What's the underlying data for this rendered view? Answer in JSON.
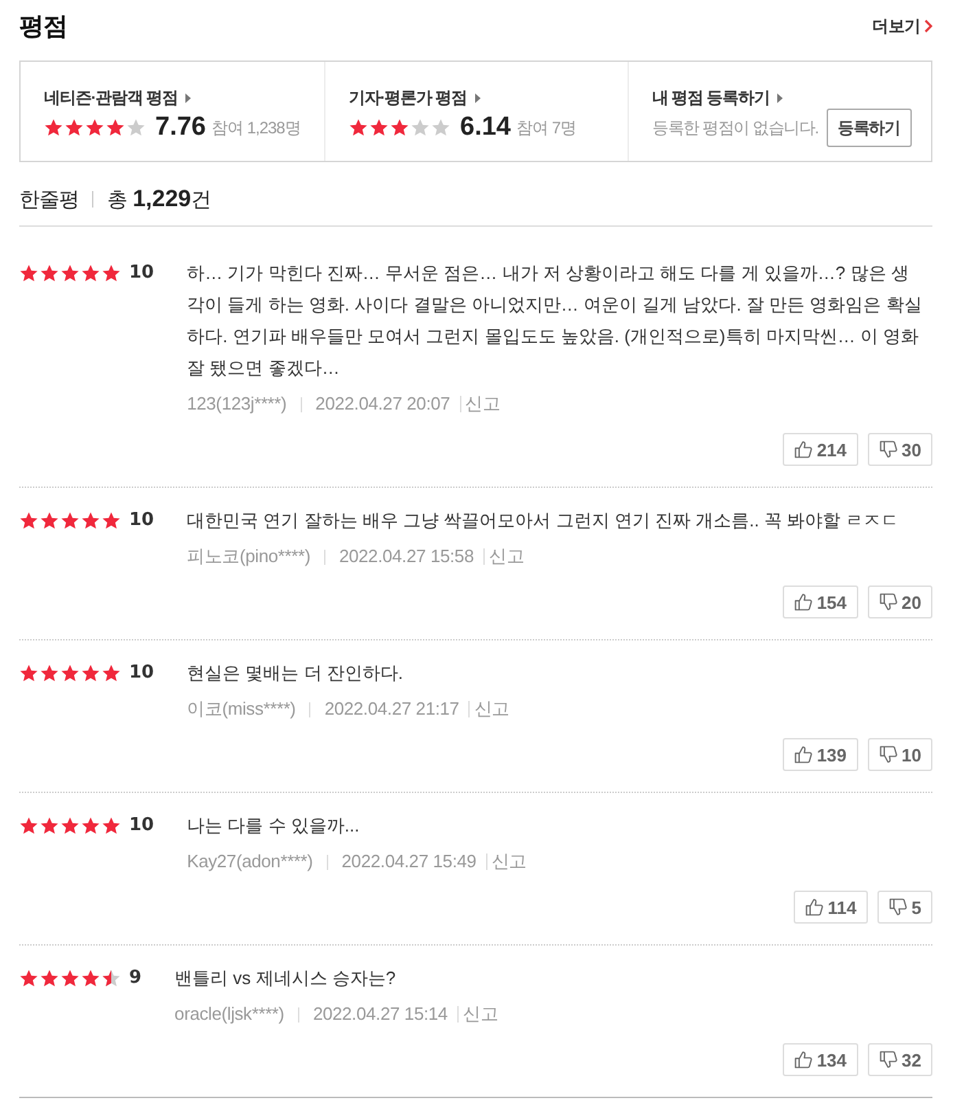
{
  "section": {
    "title": "평점",
    "more_link": "더보기"
  },
  "ratings": [
    {
      "kind": "score",
      "label": "네티즌·관람객 평점",
      "stars": 4,
      "score": "7.76",
      "participants": "참여 1,238명"
    },
    {
      "kind": "score",
      "label": "기자·평론가 평점",
      "stars": 3,
      "score": "6.14",
      "participants": "참여 7명"
    },
    {
      "kind": "register",
      "label": "내 평점 등록하기",
      "message": "등록한 평점이 없습니다.",
      "button": "등록하기"
    }
  ],
  "reviews_header": {
    "title": "한줄평",
    "total": "총 **1,229**건"
  },
  "reviews": [
    {
      "stars": 5,
      "score": "10",
      "text": "하… 기가 막힌다 진짜… 무서운 점은… 내가 저 상황이라고 해도 다를 게 있을까…? 많은 생각이 들게 하는 영화. 사이다 결말은 아니었지만… 여운이 길게 남았다. 잘 만든 영화임은 확실하다. 연기파 배우들만 모여서 그런지 몰입도도 높았음. (개인적으로)특히 마지막씬… 이 영화 잘 됐으면 좋겠다…",
      "author": "123(123j****)",
      "date": "2022.04.27 20:07",
      "report": "신고",
      "likes": "214",
      "dislikes": "30"
    },
    {
      "stars": 5,
      "score": "10",
      "text": "대한민국 연기 잘하는 배우 그냥 싹끌어모아서 그런지 연기 진짜 개소름.. 꼭 봐야할 ㄹㅈㄷ",
      "author": "피노코(pino****)",
      "date": "2022.04.27 15:58",
      "report": "신고",
      "likes": "154",
      "dislikes": "20"
    },
    {
      "stars": 5,
      "score": "10",
      "text": "현실은 몇배는 더 잔인하다.",
      "author": "이코(miss****)",
      "date": "2022.04.27 21:17",
      "report": "신고",
      "likes": "139",
      "dislikes": "10"
    },
    {
      "stars": 5,
      "score": "10",
      "text": "나는 다를 수 있을까...",
      "author": "Kay27(adon****)",
      "date": "2022.04.27 15:49",
      "report": "신고",
      "likes": "114",
      "dislikes": "5"
    },
    {
      "stars": 4.5,
      "score": "9",
      "text": "밴틀리 vs 제네시스 승자는?",
      "author": "oracle(ljsk****)",
      "date": "2022.04.27 15:14",
      "report": "신고",
      "likes": "134",
      "dislikes": "32"
    }
  ]
}
